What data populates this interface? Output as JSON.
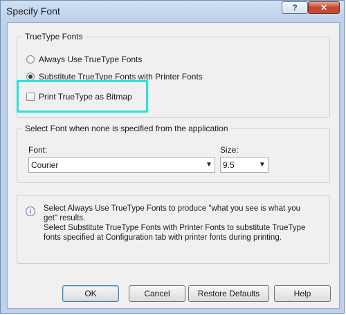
{
  "window": {
    "title": "Specify Font",
    "help_label": "?",
    "close_label": "✕"
  },
  "truetype_group": {
    "legend": "TrueType Fonts",
    "options": [
      {
        "label": "Always Use TrueType Fonts",
        "checked": false
      },
      {
        "label": "Substitute TrueType Fonts with Printer Fonts",
        "checked": true
      }
    ],
    "bitmap_checkbox": {
      "label": "Print TrueType as Bitmap",
      "checked": false
    },
    "highlight_color": "#2ee0d8"
  },
  "select_group": {
    "legend": "Select Font when none is specified from the application",
    "font_label": "Font:",
    "font_value": "Courier",
    "size_label": "Size:",
    "size_value": "9.5"
  },
  "info": {
    "icon": "info-icon",
    "lines": [
      "Select Always Use TrueType Fonts to produce \"what you see is what you",
      "get\" results.",
      "Select Substitute TrueType Fonts with Printer Fonts to substitute TrueType",
      "fonts specified at Configuration tab with printer fonts during printing."
    ]
  },
  "buttons": {
    "ok": "OK",
    "cancel": "Cancel",
    "restore": "Restore Defaults",
    "help": "Help"
  }
}
